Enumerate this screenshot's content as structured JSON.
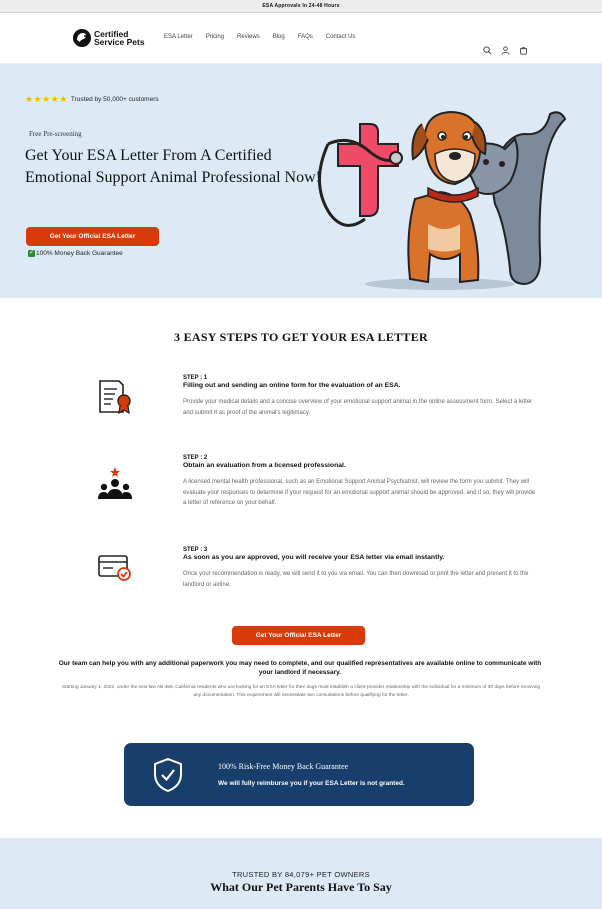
{
  "announcement": "ESA Approvals In 24-48 Hours",
  "header": {
    "logo_line1": "Certified",
    "logo_line2": "Service Pets",
    "nav": [
      "ESA Letter",
      "Pricing",
      "Reviews",
      "Blog",
      "FAQs",
      "Contact Us"
    ],
    "icons": [
      "search-icon",
      "account-icon",
      "cart-icon"
    ]
  },
  "hero": {
    "stars": 5,
    "trusted": "Trusted by 50,000+ customers",
    "prescreen": "Free Pre-screening",
    "title": "Get Your ESA Letter From A Certified Emotional Support Animal Professional Now!",
    "cta": "Get Your Official ESA Letter",
    "guarantee": "100% Money Back Guarantee"
  },
  "steps": {
    "title": "3 EASY STEPS TO GET YOUR ESA LETTER",
    "items": [
      {
        "label": "STEP : 1",
        "heading": "Filling out and sending an online form for the evaluation of an ESA.",
        "desc": "Provide your medical details and a concise overview of your emotional support animal in the online assessment form. Select a letter and submit it as proof of the animal's legitimacy.",
        "icon": "certificate-icon"
      },
      {
        "label": "STEP : 2",
        "heading": "Obtain an evaluation from a licensed professional.",
        "desc": "A licensed mental health professional, such as an Emotional Support Animal Psychiatrist, will review the form you submit. They will evaluate your responses to determine if your request for an emotional support animal should be approved, and if so, they will provide a letter of reference on your behalf.",
        "icon": "group-icon"
      },
      {
        "label": "STEP : 3",
        "heading": "As soon as you are approved, you will receive your ESA letter via email instantly.",
        "desc": "Once your recommendation is ready, we will send it to you via email. You can then download or print the letter and present it to the landlord or airline.",
        "icon": "approved-card-icon"
      }
    ],
    "cta": "Get Your Official ESA Letter"
  },
  "help_text": "Our team can help you with any additional paperwork you may need to complete, and our qualified representatives are available online to communicate with your landlord if necessary.",
  "law_text": "Starting January 1, 2022, under the new law AB 468, California residents who are looking for an ESA letter for their dogs must establish a client-provider relationship with the individual for a minimum of 30 days before receiving any documentation. This requirement will necessitate two consultations before qualifying for the letter.",
  "risk": {
    "title": "100% Risk-Free Money Back Guarantee",
    "desc": "We will fully reimburse you if your ESA Letter is not granted."
  },
  "reviews": {
    "trusted_by": "TRUSTED BY 84,079+ PET OWNERS",
    "title": "What Our Pet Parents Have To Say"
  },
  "colors": {
    "accent": "#d83a0a",
    "hero_bg": "#ddeaf6",
    "navy": "#183f6b",
    "star": "#f5b800"
  }
}
